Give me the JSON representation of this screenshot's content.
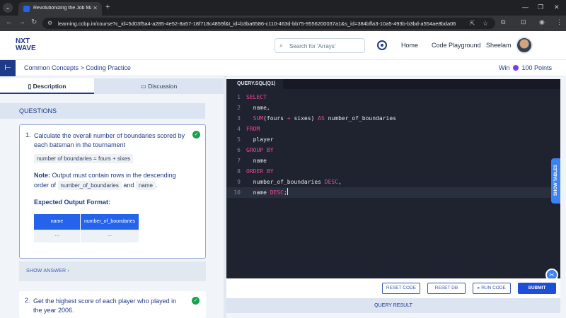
{
  "browser": {
    "tab_title": "Revolutionizing the Job Market",
    "url": "learning.ccbp.in/course?c_id=5d03f5a4-a285-4e52-8a57-18f718c4859f&t_id=b3ba6586-c110-463d-bb75-9556200037a1&s_id=384bffa3-10a5-493b-b3bd-a554ae8bda06",
    "icons": [
      "tab-list-icon",
      "back-icon",
      "forward-icon",
      "reload-icon",
      "site-info-icon",
      "share-icon",
      "star-icon",
      "extensions-icon",
      "profile-icon",
      "menu-icon"
    ]
  },
  "header": {
    "logo_line1": "NXT",
    "logo_line2": "WAVE",
    "search_placeholder": "Search for 'Arrays'",
    "nav": [
      "Home",
      "Code Playground",
      "Sheelam"
    ]
  },
  "subheader": {
    "breadcrumb": "Common Concepts > Coding Practice",
    "win_prefix": "Win",
    "win_points": "100 Points"
  },
  "left": {
    "tabs": [
      "Description",
      "Discussion"
    ],
    "questions_heading": "QUESTIONS",
    "q1": {
      "number": "1.",
      "text": "Calculate the overall number of boundaries scored by each batsman in the tournament",
      "formula": "number of boundaries = fours + sixes",
      "note_label": "Note:",
      "note_text1": "Output must contain rows in the descending order of",
      "chip1": "number_of_boundaries",
      "and": "and",
      "chip2": "name",
      "period": ".",
      "expected_label": "Expected Output Format:",
      "table_headers": [
        "name",
        "number_of_boundaries"
      ],
      "table_row": [
        "...",
        "..."
      ]
    },
    "show_answer": "SHOW ANSWER",
    "q2": {
      "number": "2.",
      "text": "Get the highest score of each player who played in the year 2006."
    }
  },
  "editor": {
    "tab": "QUERY.SQL(Q1)",
    "lines": [
      {
        "n": "1",
        "tokens": [
          {
            "t": "SELECT",
            "c": "kw"
          }
        ]
      },
      {
        "n": "2",
        "tokens": [
          {
            "t": "  name,",
            "c": ""
          }
        ]
      },
      {
        "n": "3",
        "tokens": [
          {
            "t": "  ",
            "c": ""
          },
          {
            "t": "SUM",
            "c": "kw"
          },
          {
            "t": "(fours ",
            "c": ""
          },
          {
            "t": "+",
            "c": "op"
          },
          {
            "t": " sixes) ",
            "c": ""
          },
          {
            "t": "AS",
            "c": "kw"
          },
          {
            "t": " number_of_boundaries",
            "c": ""
          }
        ]
      },
      {
        "n": "4",
        "tokens": [
          {
            "t": "FROM",
            "c": "kw"
          }
        ]
      },
      {
        "n": "5",
        "tokens": [
          {
            "t": "  player",
            "c": ""
          }
        ]
      },
      {
        "n": "6",
        "tokens": [
          {
            "t": "GROUP BY",
            "c": "kw"
          }
        ]
      },
      {
        "n": "7",
        "tokens": [
          {
            "t": "  name",
            "c": ""
          }
        ]
      },
      {
        "n": "8",
        "tokens": [
          {
            "t": "ORDER BY",
            "c": "kw"
          }
        ]
      },
      {
        "n": "9",
        "tokens": [
          {
            "t": "  number_of_boundaries ",
            "c": ""
          },
          {
            "t": "DESC",
            "c": "kw"
          },
          {
            "t": ",",
            "c": ""
          }
        ]
      },
      {
        "n": "10",
        "tokens": [
          {
            "t": "  name ",
            "c": ""
          },
          {
            "t": "DESC",
            "c": "kw"
          },
          {
            "t": ";",
            "c": ""
          }
        ]
      }
    ],
    "current_line": 10
  },
  "actions": {
    "reset_code": "RESET CODE",
    "reset_db": "RESET DB",
    "run_code": "RUN CODE",
    "submit": "SUBMIT",
    "query_result": "QUERY RESULT",
    "show_tables": "SHOW TABLES"
  },
  "colors": {
    "brand": "#1e3a8a",
    "accent": "#2563eb",
    "editor_bg": "#1f2330",
    "keyword": "#ec4899",
    "success": "#16a34a"
  }
}
